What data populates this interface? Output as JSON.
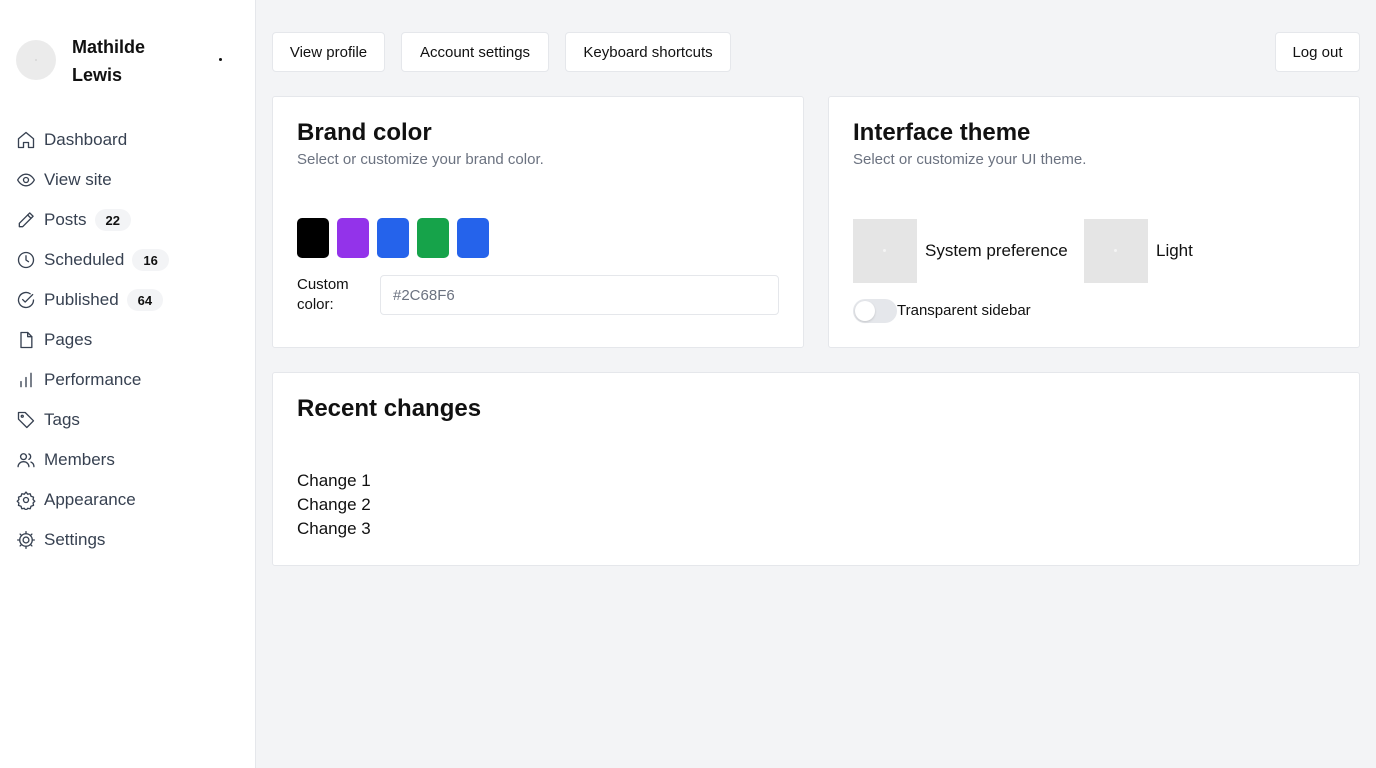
{
  "user": {
    "name": "Mathilde Lewis"
  },
  "nav": [
    {
      "label": "Dashboard",
      "icon": "home-icon"
    },
    {
      "label": "View site",
      "icon": "eye-icon"
    },
    {
      "label": "Posts",
      "icon": "pencil-icon",
      "count": "22"
    },
    {
      "label": "Scheduled",
      "icon": "clock-icon",
      "count": "16"
    },
    {
      "label": "Published",
      "icon": "check-circle-icon",
      "count": "64"
    },
    {
      "label": "Pages",
      "icon": "document-icon"
    },
    {
      "label": "Performance",
      "icon": "bar-chart-icon"
    },
    {
      "label": "Tags",
      "icon": "tag-icon"
    },
    {
      "label": "Members",
      "icon": "users-icon"
    },
    {
      "label": "Appearance",
      "icon": "gear-icon"
    },
    {
      "label": "Settings",
      "icon": "cog-icon"
    }
  ],
  "header": {
    "view_profile": "View profile",
    "account_settings": "Account settings",
    "keyboard_shortcuts": "Keyboard shortcuts",
    "log_out": "Log out"
  },
  "brand": {
    "title": "Brand color",
    "subtitle": "Select or customize your brand color.",
    "swatches": [
      "#000000",
      "#9333ea",
      "#2563eb",
      "#16a34a",
      "#2563eb"
    ],
    "custom_label": "Custom color:",
    "custom_placeholder": "#2C68F6"
  },
  "theme": {
    "title": "Interface theme",
    "subtitle": "Select or customize your UI theme.",
    "options": [
      {
        "label": "System preference"
      },
      {
        "label": "Light"
      }
    ],
    "transparent_sidebar_label": "Transparent sidebar",
    "transparent_sidebar_on": false
  },
  "recent": {
    "title": "Recent changes",
    "items": [
      "Change 1",
      "Change 2",
      "Change 3"
    ]
  },
  "colors": {
    "background": "#f3f4f6",
    "card": "#ffffff",
    "border": "#e5e7eb",
    "muted_text": "#6b7280"
  }
}
